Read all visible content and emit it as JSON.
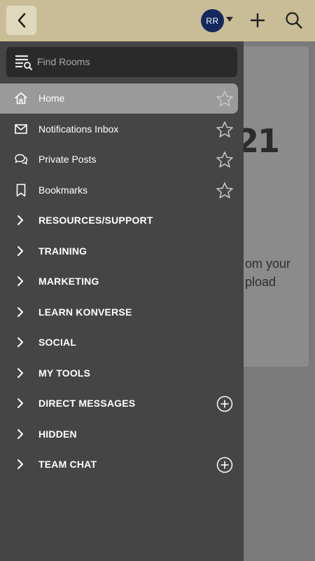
{
  "header": {
    "avatar_initials": "RR",
    "colors": {
      "bar": "#c9bd98",
      "avatar": "#13295c"
    },
    "icons": [
      "back-icon",
      "caret-down-icon",
      "plus-icon",
      "search-icon"
    ]
  },
  "background": {
    "logo_text": "21",
    "lines": [
      "om your",
      "pload"
    ]
  },
  "drawer": {
    "search": {
      "placeholder": "Find Rooms",
      "icon": "list-search-icon"
    },
    "items": [
      {
        "label": "Home",
        "icon": "home-icon",
        "active": true,
        "starred": false
      },
      {
        "label": "Notifications Inbox",
        "icon": "mail-icon",
        "active": false,
        "starred": false
      },
      {
        "label": "Private Posts",
        "icon": "chat-bubbles-icon",
        "active": false,
        "starred": false
      },
      {
        "label": "Bookmarks",
        "icon": "bookmark-icon",
        "active": false,
        "starred": false
      }
    ],
    "sections": [
      {
        "label": "RESOURCES/SUPPORT",
        "has_add": false
      },
      {
        "label": "TRAINING",
        "has_add": false
      },
      {
        "label": "MARKETING",
        "has_add": false
      },
      {
        "label": "LEARN KONVERSE",
        "has_add": false
      },
      {
        "label": "SOCIAL",
        "has_add": false
      },
      {
        "label": "MY TOOLS",
        "has_add": false
      },
      {
        "label": "DIRECT MESSAGES",
        "has_add": true
      },
      {
        "label": "HIDDEN",
        "has_add": false
      },
      {
        "label": "TEAM CHAT",
        "has_add": true
      }
    ]
  }
}
